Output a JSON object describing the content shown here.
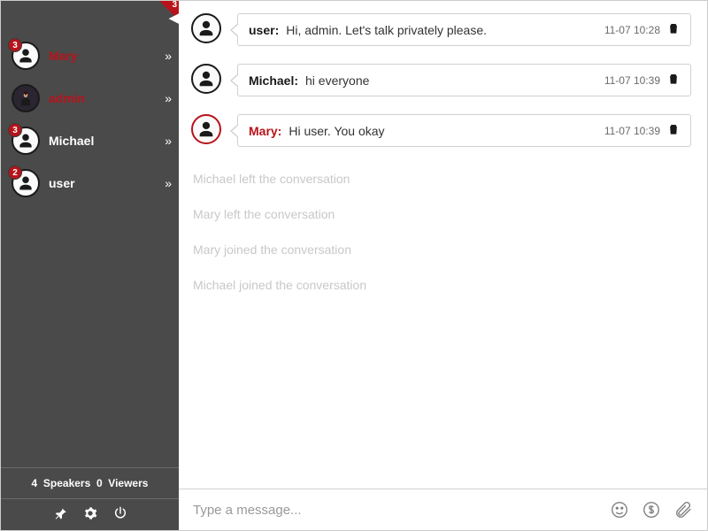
{
  "corner": {
    "count": "3"
  },
  "sidebar": {
    "items": [
      {
        "name": "Mary",
        "badge": "3",
        "color": "red",
        "avatarType": "person"
      },
      {
        "name": "admin",
        "badge": "",
        "color": "red",
        "avatarType": "dark"
      },
      {
        "name": "Michael",
        "badge": "3",
        "color": "white",
        "avatarType": "person"
      },
      {
        "name": "user",
        "badge": "2",
        "color": "white",
        "avatarType": "person"
      }
    ],
    "stats": {
      "speakers_count": "4",
      "speakers_label": "Speakers",
      "viewers_count": "0",
      "viewers_label": "Viewers"
    }
  },
  "messages": [
    {
      "sender": "user:",
      "body": "Hi, admin. Let's talk privately please.",
      "time": "11-07 10:28",
      "senderColor": "black",
      "avatarBorder": "black"
    },
    {
      "sender": "Michael:",
      "body": "hi everyone",
      "time": "11-07 10:39",
      "senderColor": "black",
      "avatarBorder": "black"
    },
    {
      "sender": "Mary:",
      "body": "Hi user. You okay",
      "time": "11-07 10:39",
      "senderColor": "red",
      "avatarBorder": "red"
    }
  ],
  "system": [
    "Michael left the conversation",
    "Mary left the conversation",
    "Mary joined the conversation",
    "Michael joined the conversation"
  ],
  "composer": {
    "placeholder": "Type a message..."
  }
}
